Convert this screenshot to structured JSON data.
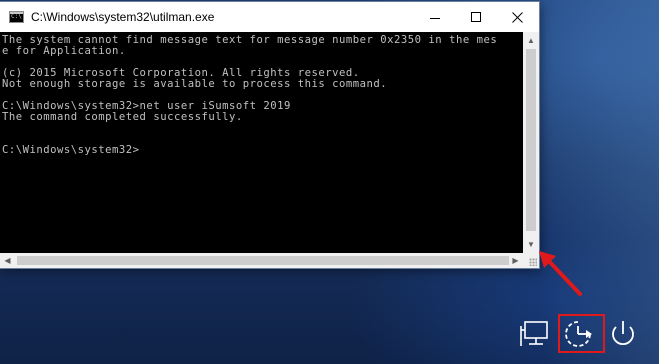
{
  "window": {
    "title": "C:\\Windows\\system32\\utilman.exe",
    "app_icon_text": "C:\\"
  },
  "console": {
    "lines": [
      "The system cannot find message text for message number 0x2350 in the mes",
      "e for Application.",
      "",
      "(c) 2015 Microsoft Corporation. All rights reserved.",
      "Not enough storage is available to process this command.",
      "",
      "C:\\Windows\\system32>net user iSumsoft 2019",
      "The command completed successfully.",
      "",
      "",
      "C:\\Windows\\system32>"
    ],
    "text_color": "#C0C0C0",
    "background": "#000000"
  },
  "icons": {
    "minimize": "minimize-icon",
    "maximize": "maximize-icon",
    "close": "close-icon",
    "network": "network-icon",
    "ease_of_access": "ease-of-access-icon",
    "power": "power-icon",
    "annotation": "red-arrow-icon"
  },
  "colors": {
    "annotation_red": "#E0191B",
    "desktop_blue": "#1A3464"
  }
}
